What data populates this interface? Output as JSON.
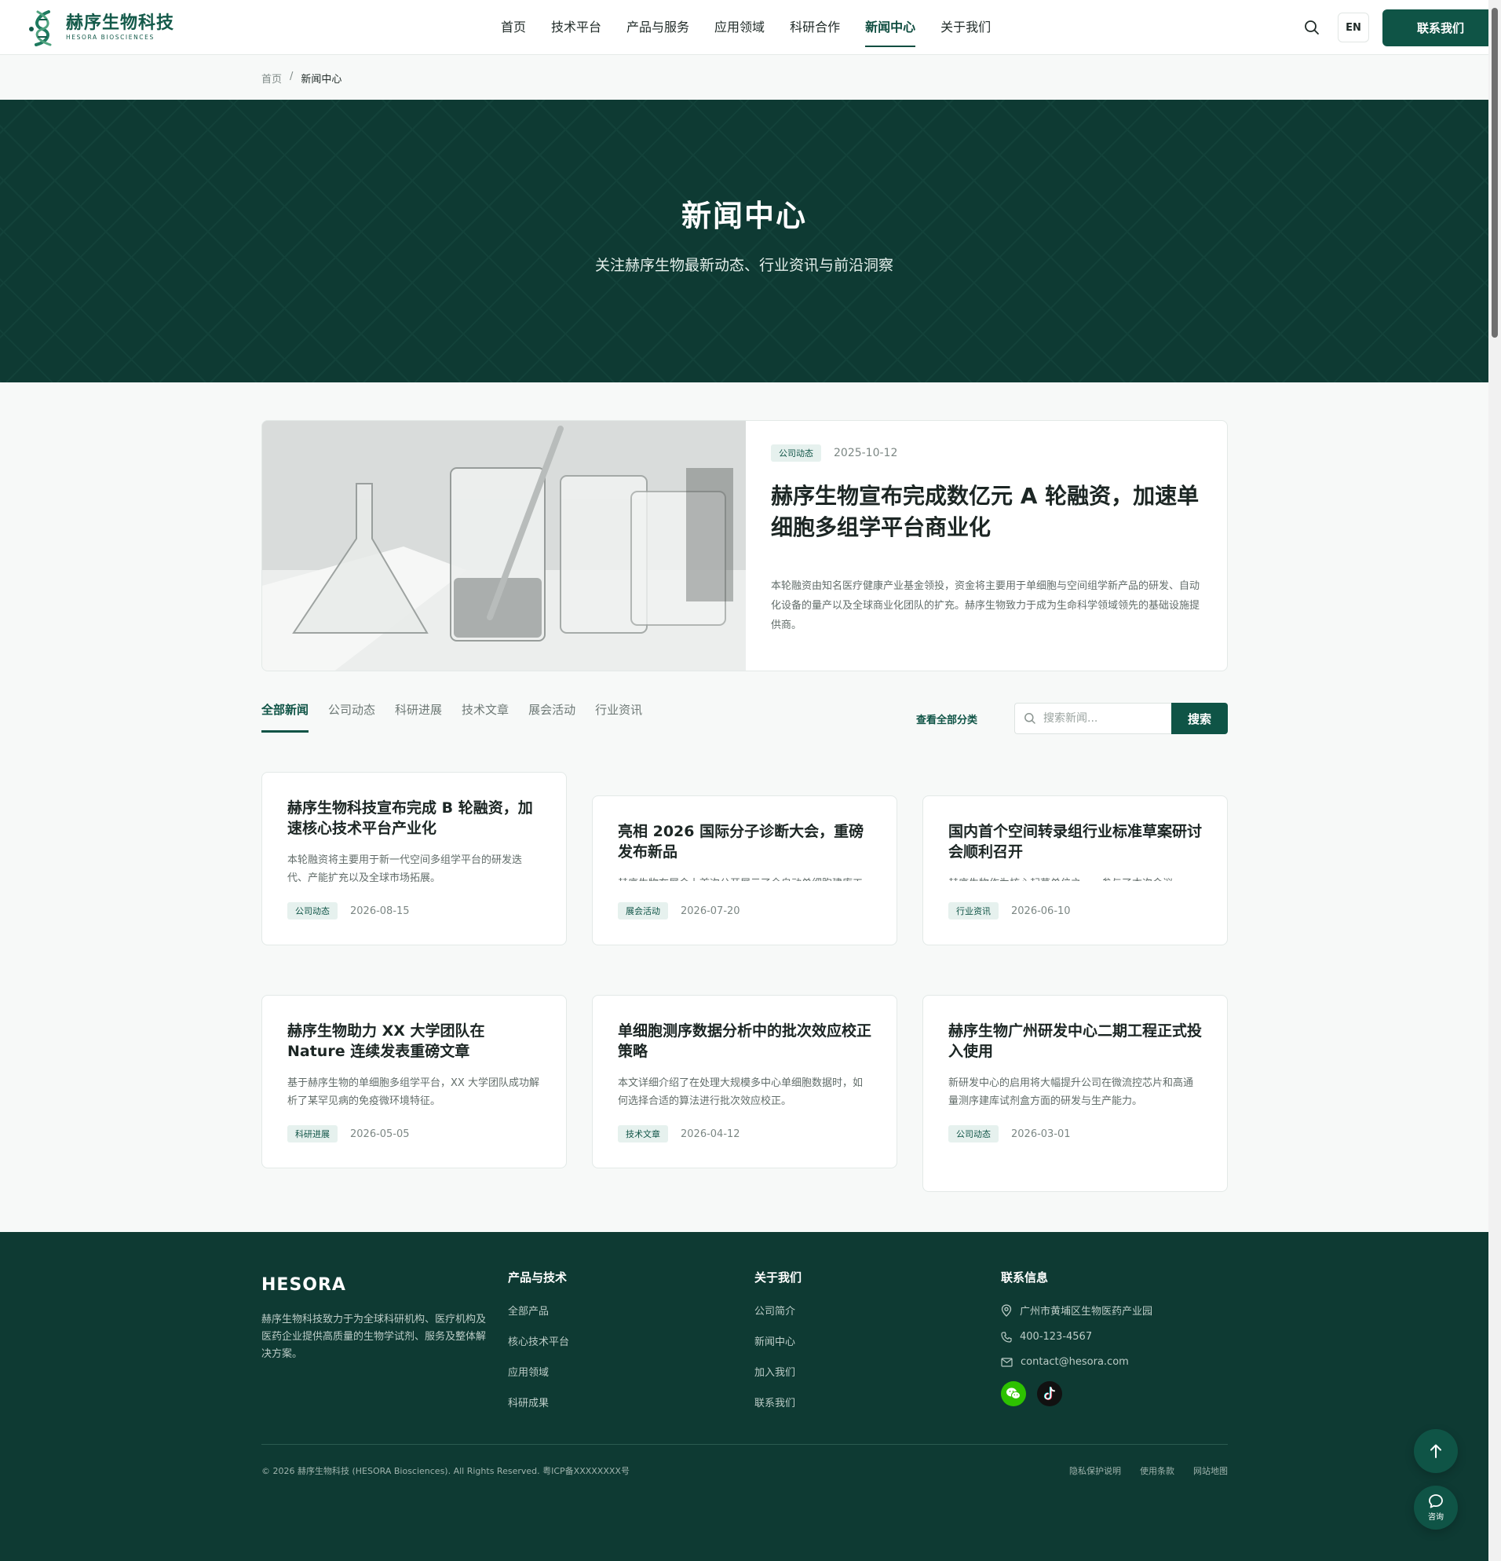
{
  "header": {
    "logo_cn": "赫序生物科技",
    "logo_en": "HESORA BIOSCIENCES",
    "nav": [
      {
        "label": "首页"
      },
      {
        "label": "技术平台"
      },
      {
        "label": "产品与服务"
      },
      {
        "label": "应用领域"
      },
      {
        "label": "科研合作"
      },
      {
        "label": "新闻中心"
      },
      {
        "label": "关于我们"
      }
    ],
    "active_nav": "新闻中心",
    "lang": "EN",
    "contact_label": "联系我们"
  },
  "breadcrumb": {
    "home": "首页",
    "separator": "/",
    "current": "新闻中心"
  },
  "hero": {
    "title": "新闻中心",
    "subtitle": "关注赫序生物最新动态、行业资讯与前沿洞察"
  },
  "featured": {
    "tag": "公司动态",
    "date": "2025-10-12",
    "title": "赫序生物宣布完成数亿元 A 轮融资，加速单细胞多组学平台商业化",
    "desc": "本轮融资由知名医疗健康产业基金领投，资金将主要用于单细胞与空间组学新产品的研发、自动化设备的量产以及全球商业化团队的扩充。赫序生物致力于成为生命科学领域领先的基础设施提供商。"
  },
  "filters": {
    "tabs": [
      {
        "label": "全部新闻"
      },
      {
        "label": "公司动态"
      },
      {
        "label": "科研进展"
      },
      {
        "label": "技术文章"
      },
      {
        "label": "展会活动"
      },
      {
        "label": "行业资讯"
      }
    ],
    "active_tab": "全部新闻",
    "view_all": "查看全部分类",
    "search_placeholder": "搜索新闻...",
    "search_button": "搜索"
  },
  "cards": [
    {
      "title": "赫序生物科技宣布完成 B 轮融资，加速核心技术平台产业化",
      "desc": "本轮融资将主要用于新一代空间多组学平台的研发迭代、产能扩充以及全球市场拓展。",
      "tag": "公司动态",
      "date": "2026-08-15"
    },
    {
      "title": "亮相 2026 国际分子诊断大会，重磅发布新品",
      "desc": "赫序生物在展会上首次公开展示了全自动单细胞建库工作站。",
      "tag": "展会活动",
      "date": "2026-07-20"
    },
    {
      "title": "国内首个空间转录组行业标准草案研讨会顺利召开",
      "desc": "赫序生物作为核心起草单位之一，参与了本次会议。",
      "tag": "行业资讯",
      "date": "2026-06-10"
    },
    {
      "title": "赫序生物助力 XX 大学团队在 Nature 连续发表重磅文章",
      "desc": "基于赫序生物的单细胞多组学平台，XX 大学团队成功解析了某罕见病的免疫微环境特征。",
      "tag": "科研进展",
      "date": "2026-05-05"
    },
    {
      "title": "单细胞测序数据分析中的批次效应校正策略",
      "desc": "本文详细介绍了在处理大规模多中心单细胞数据时，如何选择合适的算法进行批次效应校正。",
      "tag": "技术文章",
      "date": "2026-04-12"
    },
    {
      "title": "赫序生物广州研发中心二期工程正式投入使用",
      "desc": "新研发中心的启用将大幅提升公司在微流控芯片和高通量测序建库试剂盒方面的研发与生产能力。",
      "tag": "公司动态",
      "date": "2026-03-01"
    }
  ],
  "footer": {
    "brand": "HESORA",
    "brand_desc": "赫序生物科技致力于为全球科研机构、医疗机构及医药企业提供高质量的生物学试剂、服务及整体解决方案。",
    "col1": {
      "title": "产品与技术",
      "links": [
        "全部产品",
        "核心技术平台",
        "应用领域",
        "科研成果"
      ]
    },
    "col2": {
      "title": "关于我们",
      "links": [
        "公司简介",
        "新闻中心",
        "加入我们",
        "联系我们"
      ]
    },
    "contact": {
      "title": "联系信息",
      "address": "广州市黄埔区生物医药产业园",
      "phone": "400-123-4567",
      "email": "contact@hesora.com"
    },
    "copyright": "© 2026 赫序生物科技 (HESORA Biosciences). All Rights Reserved. 粤ICP备XXXXXXXX号",
    "legal": [
      "隐私保护说明",
      "使用条款",
      "网站地图"
    ]
  },
  "floating": {
    "consult_label": "咨询"
  },
  "colors": {
    "brand": "#0f5446",
    "hero_bg": "#0e3a33",
    "wechat": "#2dc100"
  }
}
